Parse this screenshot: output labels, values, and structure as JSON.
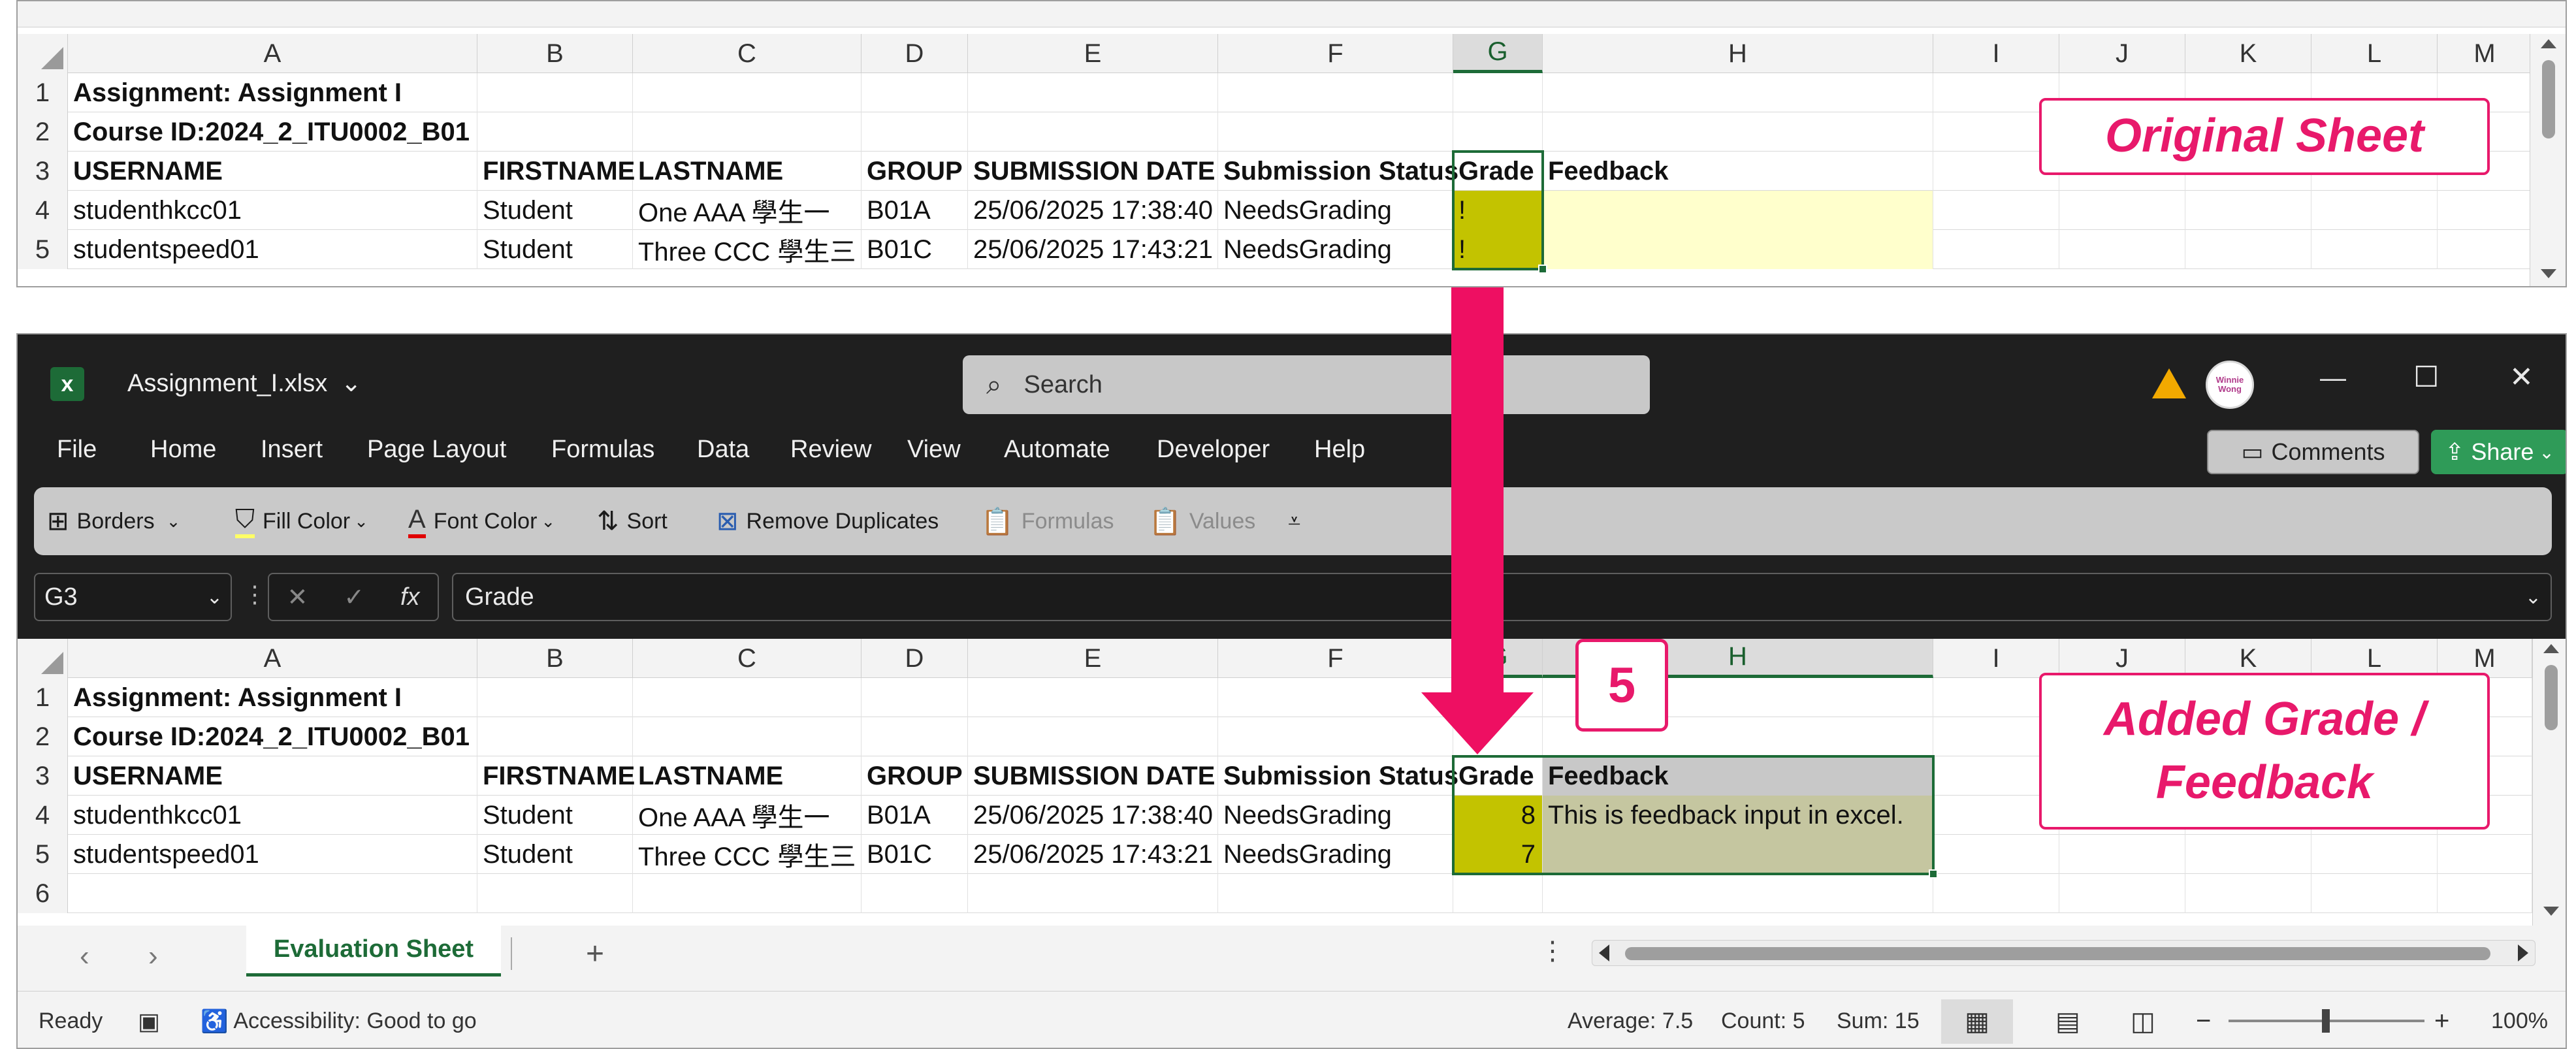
{
  "columns": [
    {
      "id": "A",
      "label": "A"
    },
    {
      "id": "B",
      "label": "B"
    },
    {
      "id": "C",
      "label": "C"
    },
    {
      "id": "D",
      "label": "D"
    },
    {
      "id": "E",
      "label": "E"
    },
    {
      "id": "F",
      "label": "F"
    },
    {
      "id": "G",
      "label": "G"
    },
    {
      "id": "H",
      "label": "H"
    },
    {
      "id": "I",
      "label": "I"
    },
    {
      "id": "J",
      "label": "J"
    },
    {
      "id": "K",
      "label": "K"
    },
    {
      "id": "L",
      "label": "L"
    },
    {
      "id": "M",
      "label": "M"
    }
  ],
  "original_sheet": {
    "callout": "Original Sheet",
    "rows": [
      {
        "num": "1",
        "cells": {
          "A": "Assignment: Assignment I"
        }
      },
      {
        "num": "2",
        "cells": {
          "A": "Course ID:2024_2_ITU0002_B01"
        }
      },
      {
        "num": "3",
        "cells": {
          "A": "USERNAME",
          "B": "FIRSTNAME",
          "C": "LASTNAME",
          "D": "GROUP",
          "E": "SUBMISSION DATE",
          "F": "Submission Status",
          "G": "Grade",
          "H": "Feedback"
        }
      },
      {
        "num": "4",
        "cells": {
          "A": "studenthkcc01",
          "B": "Student",
          "C": "One AAA 學生一",
          "D": "B01A",
          "E": "25/06/2025 17:38:40",
          "F": "NeedsGrading",
          "G": "!",
          "H": ""
        }
      },
      {
        "num": "5",
        "cells": {
          "A": "studentspeed01",
          "B": "Student",
          "C": "Three CCC 學生三",
          "D": "B01C",
          "E": "25/06/2025 17:43:21",
          "F": "NeedsGrading",
          "G": "!",
          "H": ""
        }
      }
    ]
  },
  "window": {
    "filename": "Assignment_I.xlsx",
    "search_placeholder": "Search",
    "avatar_text": "Winnie Wong",
    "controls": {
      "minimize": "—",
      "maximize": "☐",
      "close": "✕"
    }
  },
  "menu": {
    "items": [
      "File",
      "Home",
      "Insert",
      "Page Layout",
      "Formulas",
      "Data",
      "Review",
      "View",
      "Automate",
      "Developer",
      "Help"
    ],
    "comments": "Comments",
    "share": "Share"
  },
  "ribbon": {
    "borders": "Borders",
    "fill_color": "Fill Color",
    "font_color": "Font Color",
    "sort": "Sort",
    "remove_duplicates": "Remove Duplicates",
    "formulas": "Formulas",
    "values": "Values"
  },
  "formula_bar": {
    "name_box": "G3",
    "fx": "fx",
    "content": "Grade"
  },
  "added_sheet": {
    "callout": "Added Grade / Feedback",
    "step_badge": "5",
    "rows": [
      {
        "num": "1",
        "cells": {
          "A": "Assignment: Assignment I"
        }
      },
      {
        "num": "2",
        "cells": {
          "A": "Course ID:2024_2_ITU0002_B01"
        }
      },
      {
        "num": "3",
        "cells": {
          "A": "USERNAME",
          "B": "FIRSTNAME",
          "C": "LASTNAME",
          "D": "GROUP",
          "E": "SUBMISSION DATE",
          "F": "Submission Status",
          "G": "Grade",
          "H": "Feedback"
        }
      },
      {
        "num": "4",
        "cells": {
          "A": "studenthkcc01",
          "B": "Student",
          "C": "One AAA 學生一",
          "D": "B01A",
          "E": "25/06/2025 17:38:40",
          "F": "NeedsGrading",
          "G": "8",
          "H": "This is feedback input in excel."
        }
      },
      {
        "num": "5",
        "cells": {
          "A": "studentspeed01",
          "B": "Student",
          "C": "Three CCC 學生三",
          "D": "B01C",
          "E": "25/06/2025 17:43:21",
          "F": "NeedsGrading",
          "G": "7",
          "H": ""
        }
      },
      {
        "num": "6",
        "cells": {}
      }
    ]
  },
  "sheet_tabs": {
    "active": "Evaluation Sheet",
    "add": "+"
  },
  "status_bar": {
    "ready": "Ready",
    "accessibility": "Accessibility: Good to go",
    "average": "Average: 7.5",
    "count": "Count: 5",
    "sum": "Sum: 15",
    "zoom": "100%"
  },
  "colors": {
    "accent": "#e8196b",
    "excel_green": "#1d6b37",
    "grade_fill": "#c3c300",
    "feedback_fill_original": "#ffffcc",
    "feedback_fill_selected": "#c5c6a0",
    "share_green": "#2f9b58"
  }
}
